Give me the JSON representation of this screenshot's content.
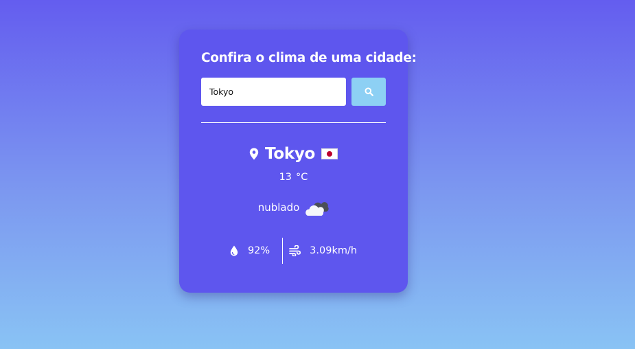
{
  "card": {
    "title": "Confira o clima de uma cidade:",
    "search": {
      "value": "Tokyo",
      "button_icon": "search-icon"
    }
  },
  "weather": {
    "city": "Tokyo",
    "country_flag": "japan-flag-icon",
    "temperature": "13",
    "temperature_unit": "°C",
    "description": "nublado",
    "description_icon": "cloud-icon",
    "humidity": "92%",
    "humidity_icon": "water-drop-icon",
    "wind": "3.09km/h",
    "wind_icon": "wind-icon"
  },
  "colors": {
    "background_top": "#645def",
    "background_bottom": "#89c3f4",
    "card": "#5e56ee",
    "search_button": "#8dd0f4",
    "text": "#ffffff"
  }
}
